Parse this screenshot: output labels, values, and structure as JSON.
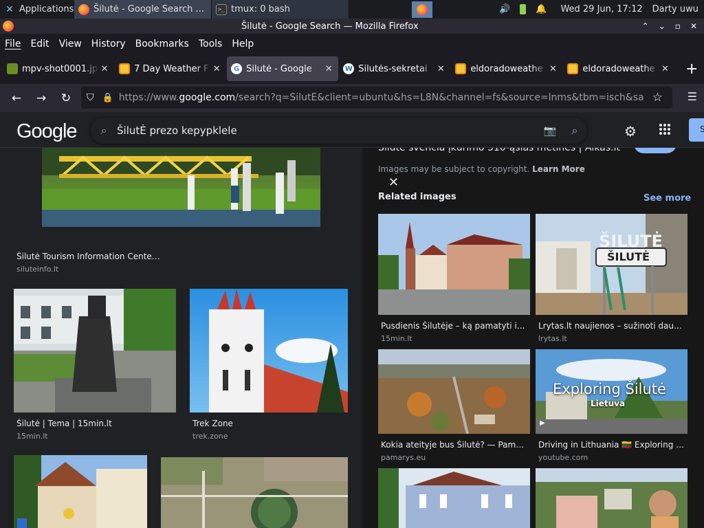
{
  "taskbar": {
    "apps_label": "Applications",
    "window1": "Šilutė - Google Search ...",
    "window2": "tmux: 0 bash",
    "clock": "Wed 29 Jun, 17:12",
    "user": "Darty uwu"
  },
  "window": {
    "title": "Šilutė - Google Search — Mozilla Firefox"
  },
  "menu": {
    "file": "File",
    "edit": "Edit",
    "view": "View",
    "history": "History",
    "bookmarks": "Bookmarks",
    "tools": "Tools",
    "help": "Help"
  },
  "tabs": [
    {
      "label": "mpv-shot0001.jp"
    },
    {
      "label": "7 Day Weather F"
    },
    {
      "label": "Šilutė - Google"
    },
    {
      "label": "Šilutės-sekretai"
    },
    {
      "label": "eldoradoweathe"
    },
    {
      "label": "eldoradoweathe"
    }
  ],
  "url": {
    "pre": "https://www.",
    "domain": "google.com",
    "post": "/search?q=ŠilutĖ&client=ubuntu&hs=L8N&channel=fs&source=lnms&tbm=isch&sa"
  },
  "google": {
    "logo": "Google",
    "query": "ŠilutĖ prezo kepypklele"
  },
  "left_results": [
    {
      "title": "Šilutė Tourism Information Cente ...",
      "source": "siluteinfo.lt"
    },
    {
      "title": "Šilutė | Tema | 15min.lt",
      "source": "15min.lt"
    },
    {
      "title": "Trek Zone",
      "source": "trek.zone"
    }
  ],
  "right_pane": {
    "title": "Šilutė švencia įkūrimo 510-ąsias metines | Alkas.lt",
    "copyright": "Images may be subject to copyright.",
    "learn_more": "Learn More",
    "related": "Related images",
    "see_more": "See more",
    "items": [
      {
        "title": "Pusdienis Šilutėje – ką pamatyti ir ap...",
        "source": "15min.lt"
      },
      {
        "title": "Lrytas.lt naujienos – sužinoti daugiau!",
        "source": "lrytas.lt"
      },
      {
        "title": "Kokia ateityje bus Šilutė? — Pamarys",
        "source": "pamarys.eu"
      },
      {
        "title": "Driving in Lithuania 🇱🇹 Exploring Šilut...",
        "source": "youtube.com"
      }
    ],
    "sign_text": "ŠILUTĖ",
    "video_title": "Exploring Šilutė",
    "video_sub": "Lietuva"
  }
}
